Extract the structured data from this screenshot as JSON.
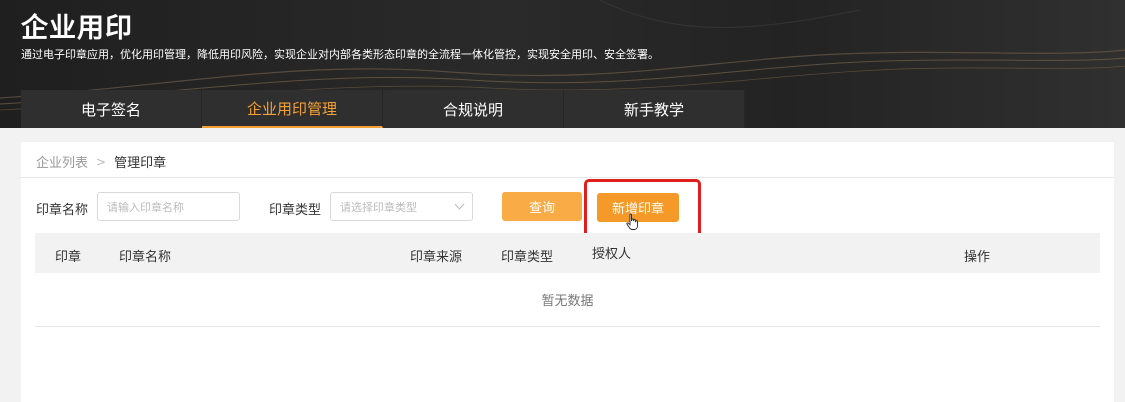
{
  "header": {
    "title": "企业用印",
    "description": "通过电子印章应用，优化用印管理，降低用印风险，实现企业对内部各类形态印章的全流程一体化管控，实现安全用印、安全签署。"
  },
  "tabs": [
    {
      "label": "电子签名"
    },
    {
      "label": "企业用印管理"
    },
    {
      "label": "合规说明"
    },
    {
      "label": "新手教学"
    }
  ],
  "breadcrumb": {
    "parent": "企业列表",
    "separator": ">",
    "current": "管理印章"
  },
  "filters": {
    "seal_name_label": "印章名称",
    "seal_name_placeholder": "请输入印章名称",
    "seal_type_label": "印章类型",
    "seal_type_placeholder": "请选择印章类型"
  },
  "buttons": {
    "query": "查询",
    "add": "新增印章"
  },
  "table": {
    "columns": [
      "印章",
      "印章名称",
      "印章来源",
      "印章类型",
      "授权人",
      "操作"
    ],
    "empty_text": "暂无数据"
  },
  "colors": {
    "accent": "#f59a28",
    "highlight": "#e01e1e",
    "header_bg": "#232323"
  }
}
